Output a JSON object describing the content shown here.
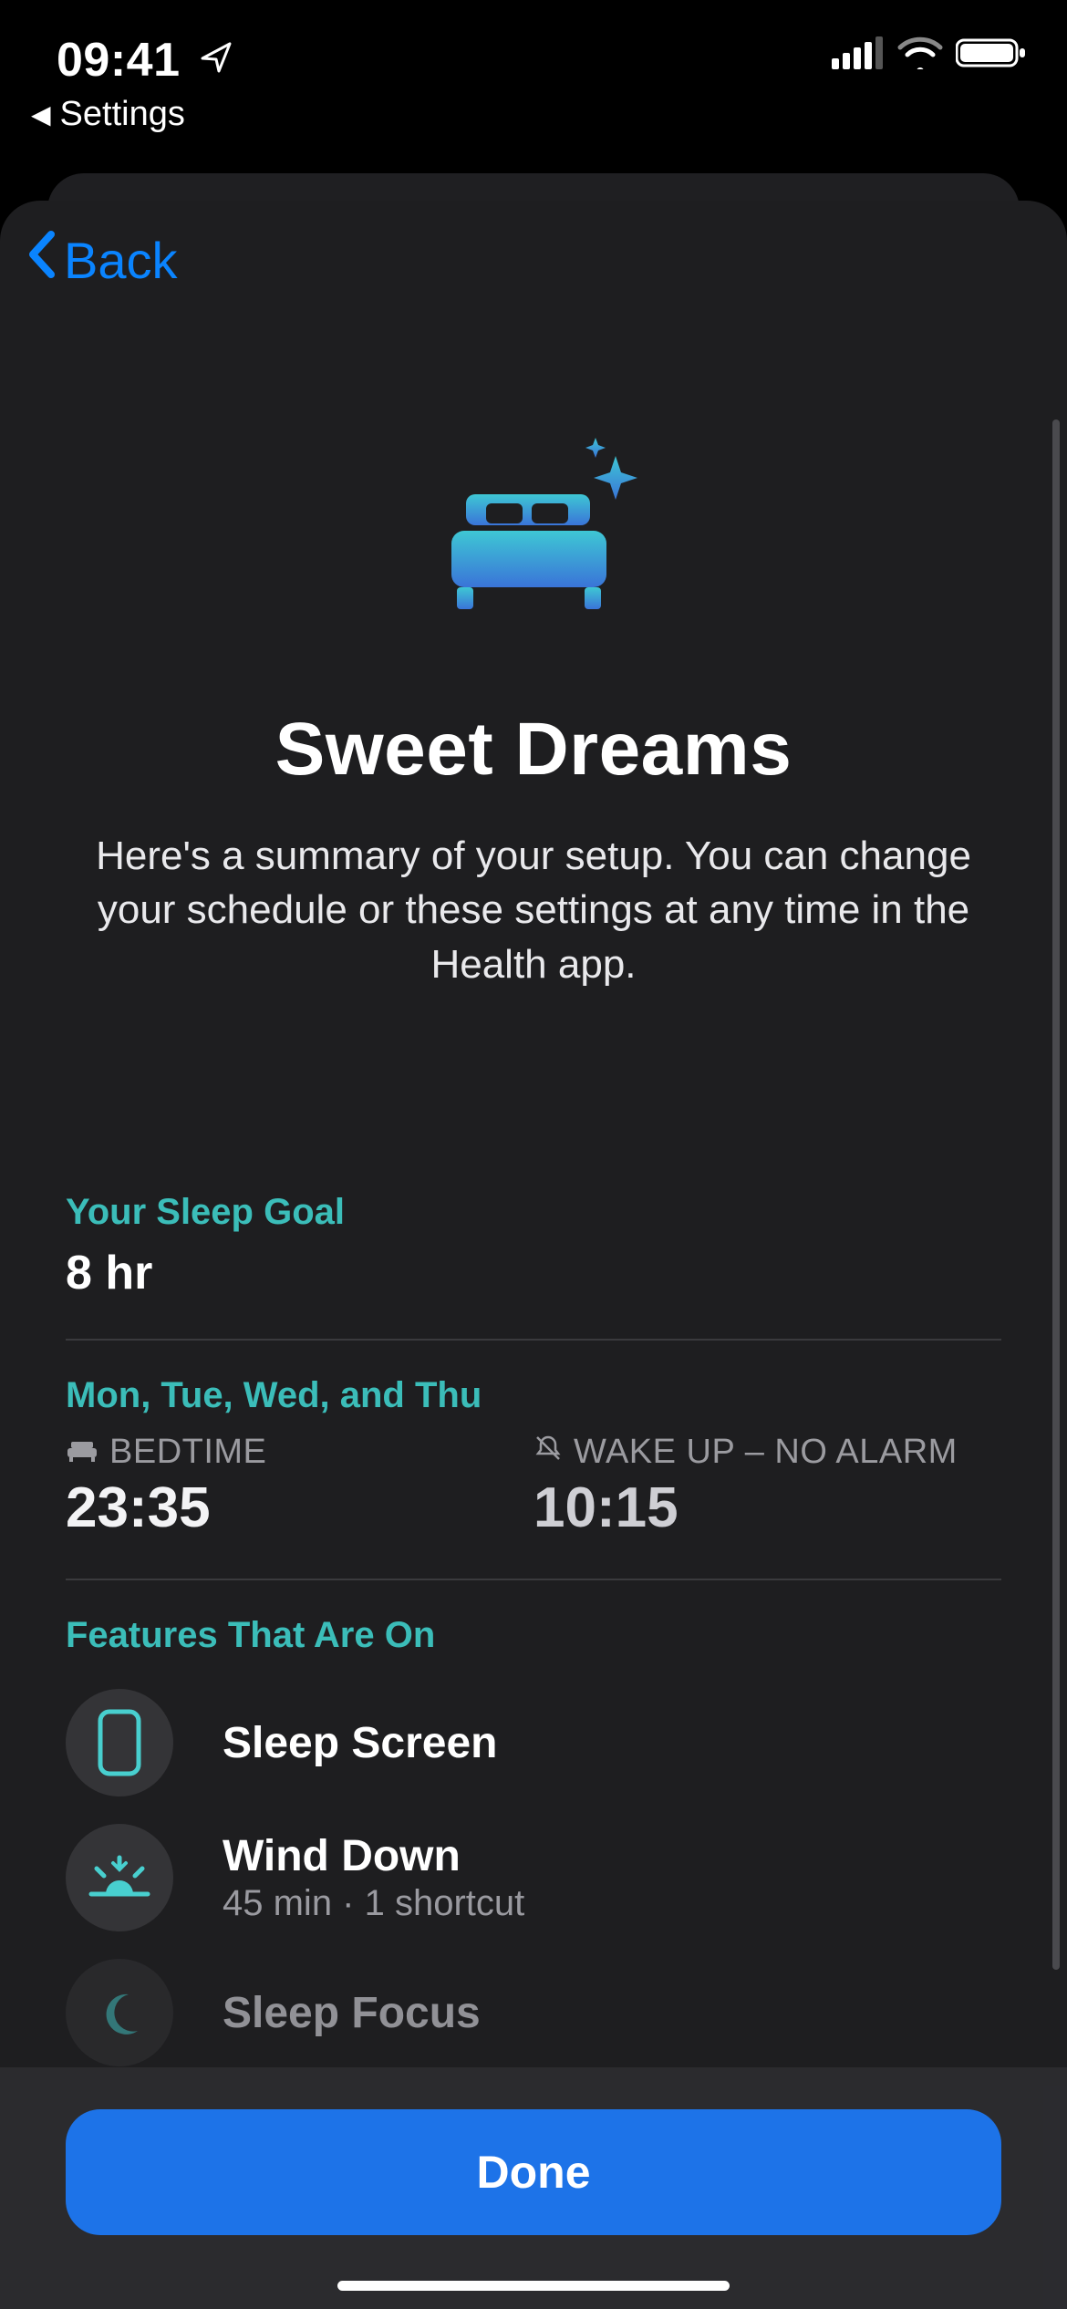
{
  "statusbar": {
    "time": "09:41",
    "return_to_label": "Settings"
  },
  "nav": {
    "back_label": "Back"
  },
  "hero": {
    "title": "Sweet Dreams",
    "subtitle": "Here's a summary of your setup. You can change your schedule or these settings at any time in the Health app."
  },
  "goal": {
    "label": "Your Sleep Goal",
    "value": "8 hr"
  },
  "schedule": {
    "days_label": "Mon, Tue, Wed, and Thu",
    "bedtime_label": "BEDTIME",
    "bedtime_value": "23:35",
    "wake_label": "WAKE UP – NO ALARM",
    "wake_value": "10:15"
  },
  "features": {
    "label": "Features That Are On",
    "items": [
      {
        "title": "Sleep Screen",
        "sub": ""
      },
      {
        "title": "Wind Down",
        "sub": "45 min · 1 shortcut"
      },
      {
        "title": "Sleep Focus",
        "sub": ""
      }
    ]
  },
  "footer": {
    "done_label": "Done"
  }
}
